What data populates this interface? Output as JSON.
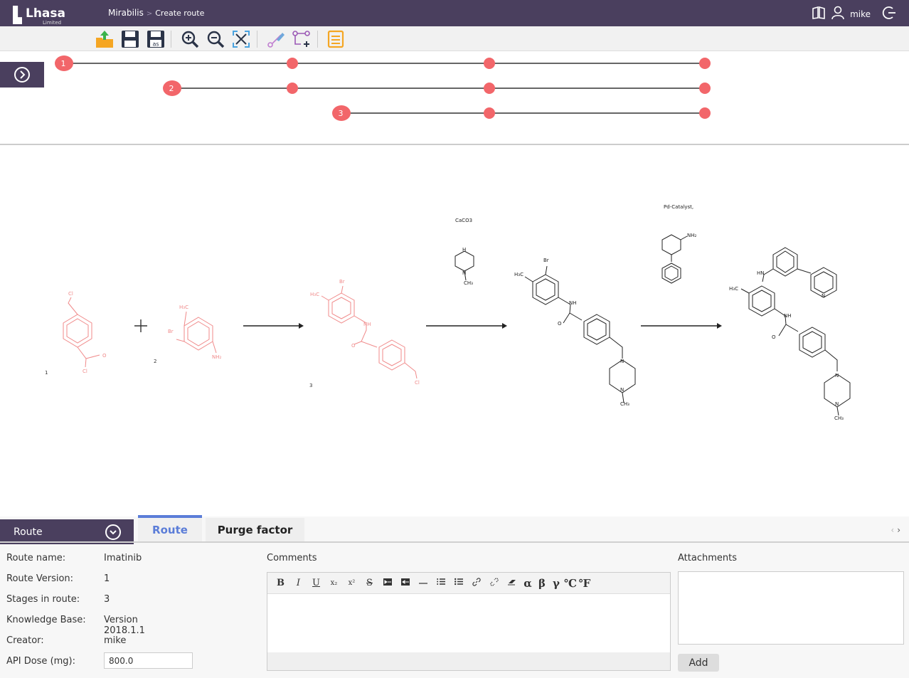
{
  "brand": {
    "name": "Lhasa",
    "sub": "Limited"
  },
  "breadcrumbs": {
    "app": "Mirabilis",
    "page": "Create route"
  },
  "user": {
    "name": "mike"
  },
  "colors": {
    "header": "#4a3f5e",
    "accent": "#5b7dd8",
    "node": "#f2666a",
    "reactant": "#f08a8a"
  },
  "toolbar": {
    "items": [
      "import-icon",
      "save-icon",
      "save-as-icon",
      "zoom-in-icon",
      "zoom-out-icon",
      "fit-icon",
      "edit-stage-icon",
      "add-stage-icon",
      "report-icon"
    ],
    "save_as_text": "as"
  },
  "timeline": {
    "stages": [
      "1",
      "2",
      "3"
    ]
  },
  "scheme": {
    "labels": {
      "c1": "1",
      "c2": "2",
      "c3": "3"
    },
    "reagents": {
      "step2": "CaCO3",
      "step3": "Pd-Catalyst,"
    },
    "atoms": {
      "cl": "Cl",
      "o": "O",
      "br": "Br",
      "h3c": "H₃C",
      "nh2": "NH₂",
      "nh": "NH",
      "n": "N",
      "h": "H",
      "ch3": "CH₃",
      "hn": "HN"
    }
  },
  "bottom": {
    "panel_title": "Route",
    "tabs": {
      "route": "Route",
      "purge": "Purge factor"
    },
    "props": {
      "route_name_label": "Route name:",
      "route_name": "Imatinib",
      "route_version_label": "Route Version:",
      "route_version": "1",
      "stages_label": "Stages in route:",
      "stages": "3",
      "kb_label": "Knowledge Base:",
      "kb": "Version 2018.1.1",
      "creator_label": "Creator:",
      "creator": "mike",
      "dose_label": "API Dose (mg):",
      "dose": "800.0"
    },
    "comments_label": "Comments",
    "editor_tools": {
      "bold": "B",
      "italic": "I",
      "underline": "U",
      "sub": "x₂",
      "sup": "x²",
      "strike": "S",
      "alpha": "α",
      "beta": "β",
      "gamma": "γ",
      "celsius": "℃",
      "fahrenheit": "℉"
    },
    "attachments_label": "Attachments",
    "add_label": "Add"
  }
}
